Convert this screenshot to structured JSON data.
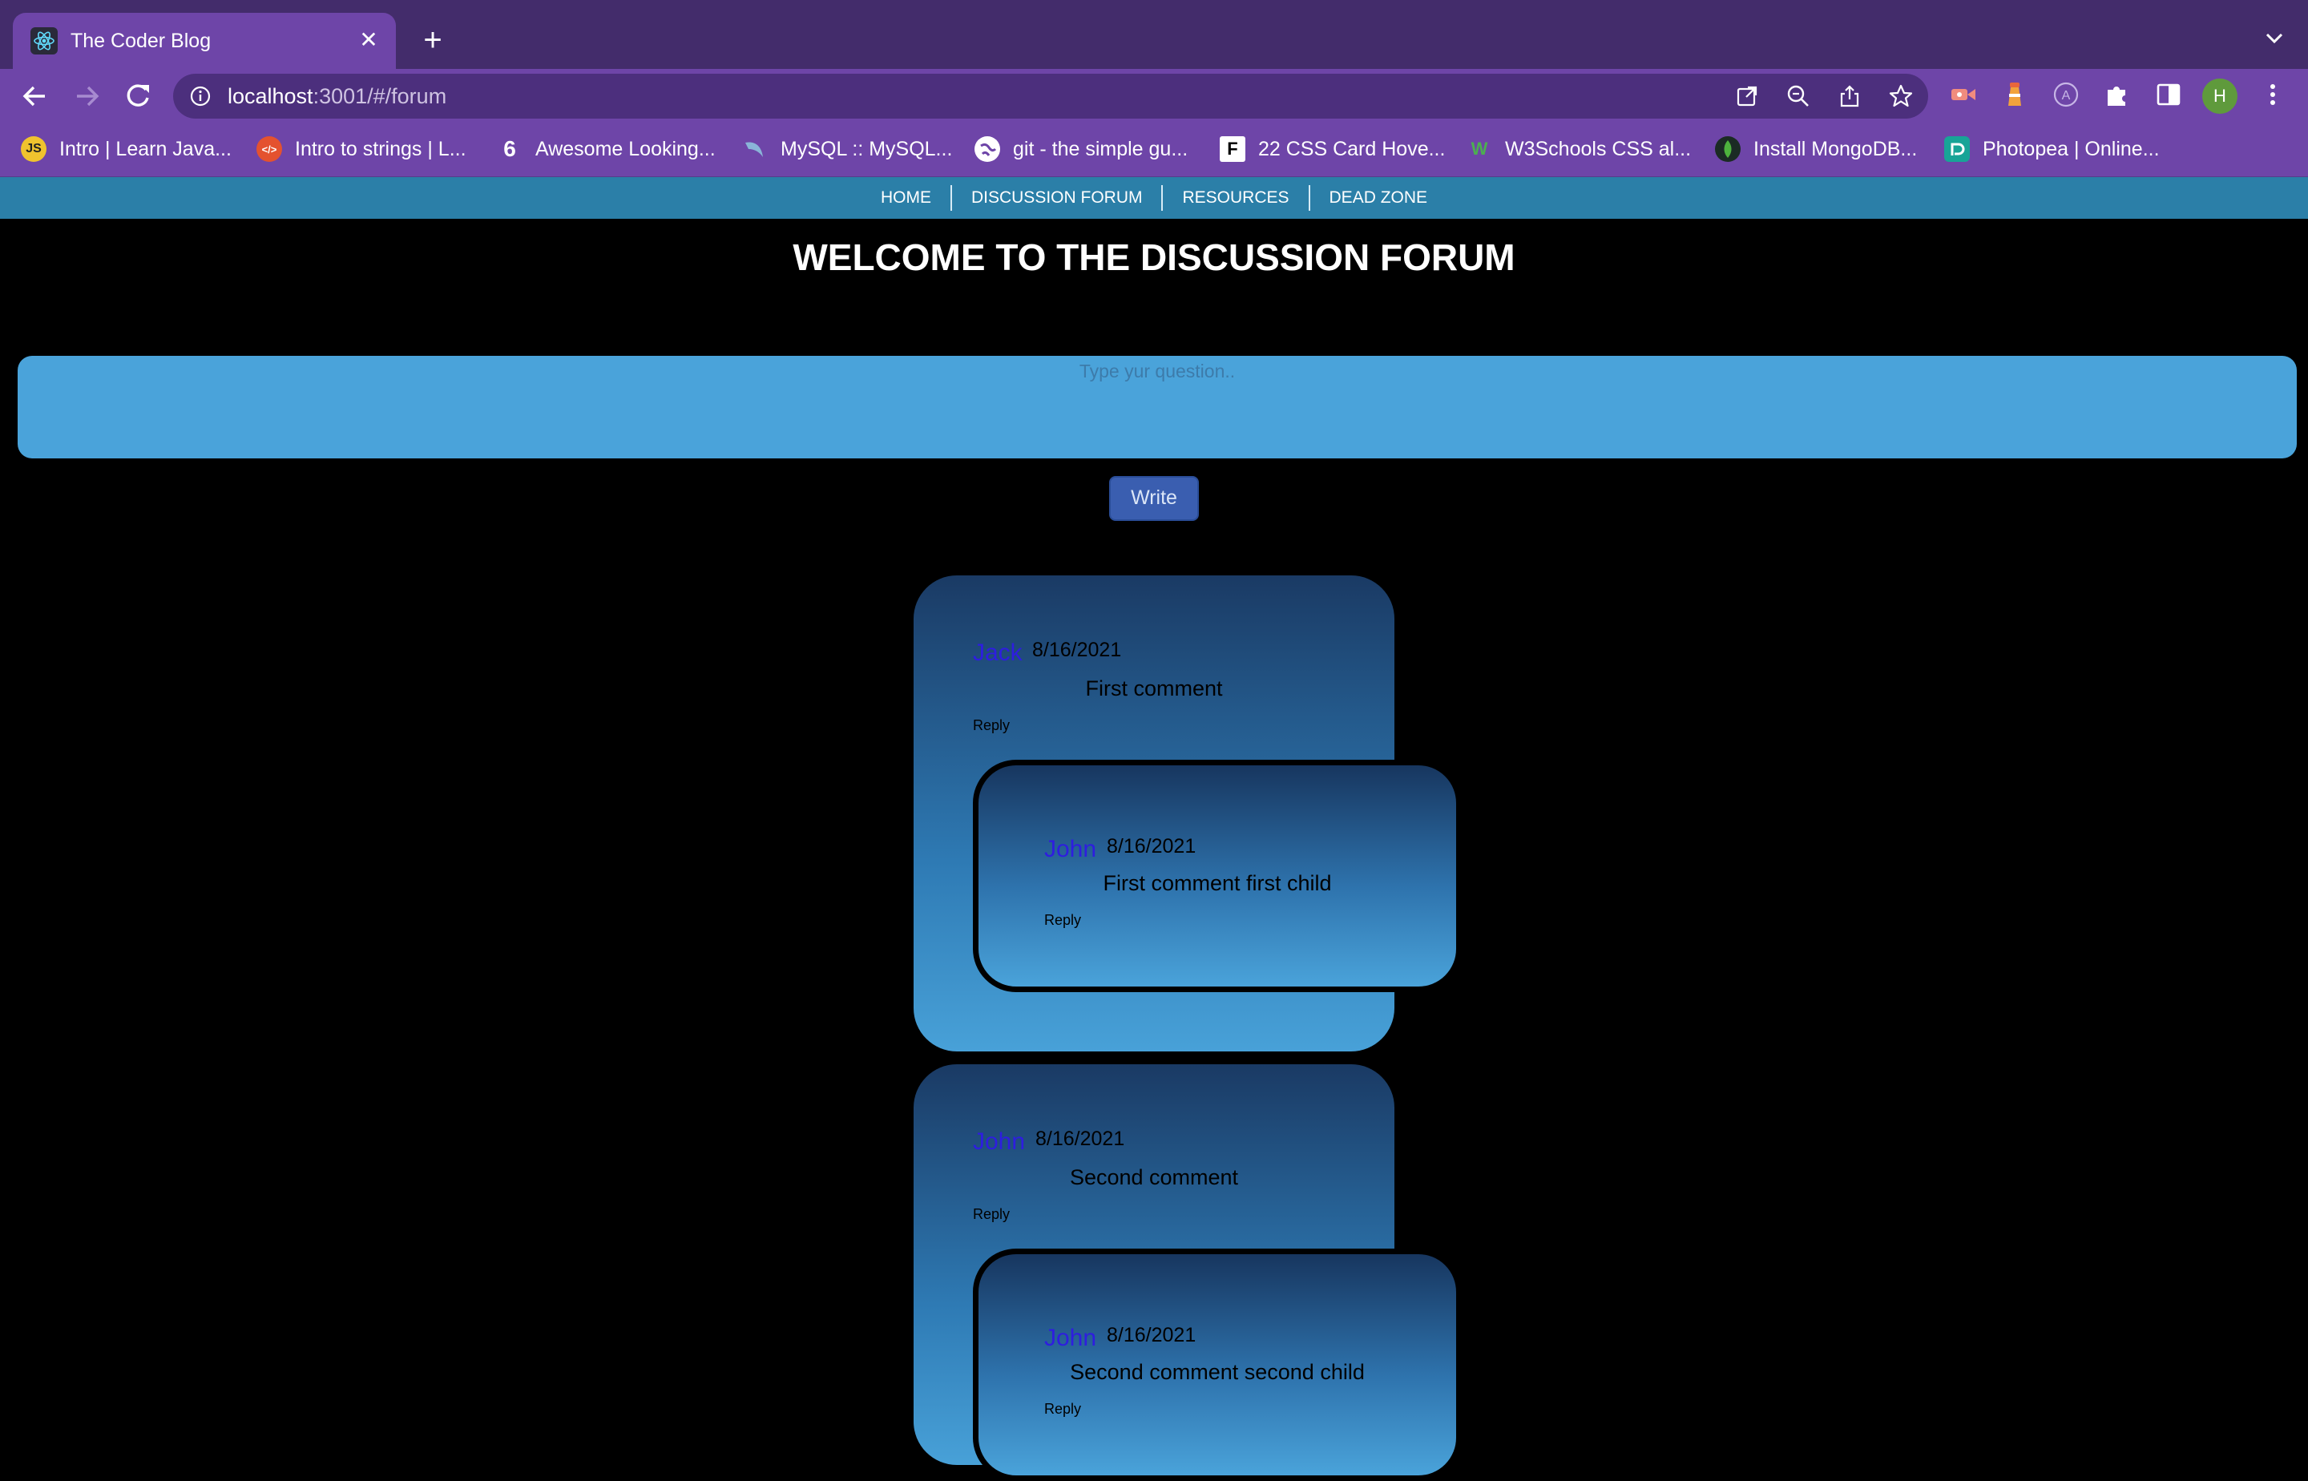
{
  "browser": {
    "tab_title": "The Coder Blog",
    "url_host": "localhost",
    "url_rest": ":3001/#/forum",
    "bookmarks": [
      {
        "label": "Intro | Learn Java...",
        "icon": "js-icon"
      },
      {
        "label": "Intro to strings | L...",
        "icon": "code-icon"
      },
      {
        "label": "Awesome Looking...",
        "icon": "six-icon"
      },
      {
        "label": "MySQL :: MySQL...",
        "icon": "mysql-dolphin-icon"
      },
      {
        "label": "git - the simple gu...",
        "icon": "globe-icon"
      },
      {
        "label": "22 CSS Card Hove...",
        "icon": "f-logo-icon"
      },
      {
        "label": "W3Schools CSS al...",
        "icon": "w3-icon"
      },
      {
        "label": "Install MongoDB...",
        "icon": "mongodb-leaf-icon"
      },
      {
        "label": "Photopea | Online...",
        "icon": "photopea-icon"
      }
    ],
    "profile_initial": "H"
  },
  "site_nav": [
    "HOME",
    "DISCUSSION FORUM",
    "RESOURCES",
    "DEAD ZONE"
  ],
  "page": {
    "title": "WELCOME TO THE DISCUSSION FORUM",
    "question_placeholder": "Type yur question..",
    "write_label": "Write"
  },
  "comments": [
    {
      "author": "Jack",
      "date": "8/16/2021",
      "text": "First comment",
      "reply": "Reply",
      "child": {
        "author": "John",
        "date": "8/16/2021",
        "text": "First comment first child",
        "reply": "Reply"
      }
    },
    {
      "author": "John",
      "date": "8/16/2021",
      "text": "Second comment",
      "reply": "Reply",
      "child": {
        "author": "John",
        "date": "8/16/2021",
        "text": "Second comment second child",
        "reply": "Reply"
      }
    }
  ],
  "colors": {
    "tab_bar": "#432c6b",
    "toolbar": "#6e45a8",
    "site_nav": "#2b7fa8",
    "question_box": "#4aa3da",
    "author_link": "#2e1de0"
  }
}
